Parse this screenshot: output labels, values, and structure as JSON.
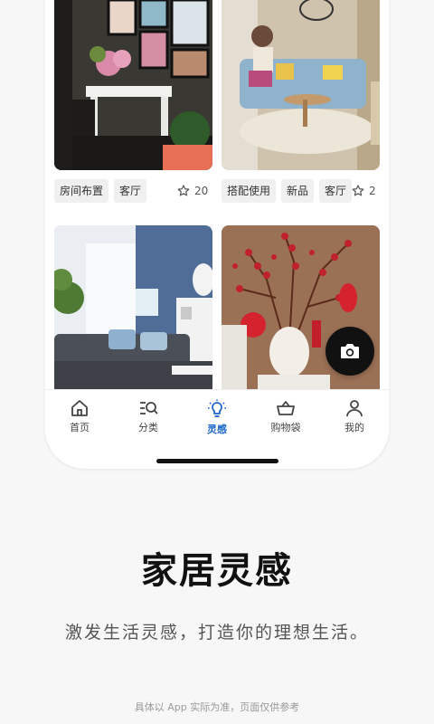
{
  "feed": {
    "cards": [
      {
        "tags": [
          "房间布置",
          "客厅"
        ],
        "likes": "20"
      },
      {
        "tags": [
          "搭配使用",
          "新品",
          "客厅"
        ],
        "likes": "2"
      },
      {
        "tags": [],
        "likes": ""
      },
      {
        "tags": [],
        "likes": ""
      }
    ]
  },
  "tabbar": {
    "items": [
      {
        "label": "首页",
        "icon": "home-icon"
      },
      {
        "label": "分类",
        "icon": "category-search-icon"
      },
      {
        "label": "灵感",
        "icon": "lightbulb-icon",
        "active": true
      },
      {
        "label": "购物袋",
        "icon": "shopping-basket-icon"
      },
      {
        "label": "我的",
        "icon": "person-icon"
      }
    ]
  },
  "promo": {
    "headline": "家居灵感",
    "subline": "激发生活灵感，打造你的理想生活。",
    "disclaimer": "具体以 App 实际为准，页面仅供参考"
  },
  "colors": {
    "accent": "#1a66c9",
    "camera_button": "#111111"
  }
}
